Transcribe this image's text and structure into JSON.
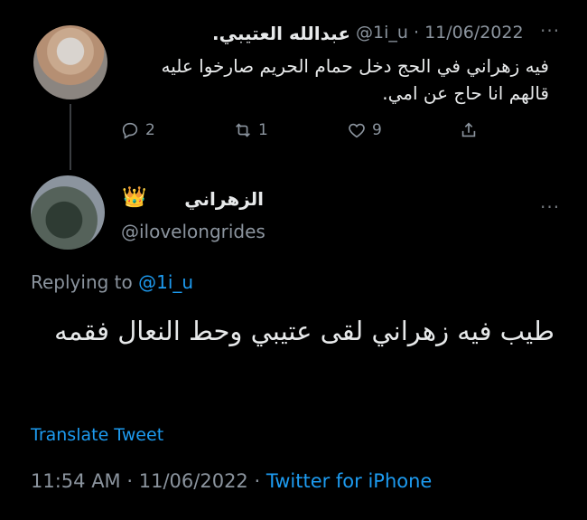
{
  "tweet1": {
    "display_name": "عبدالله العتيبي.",
    "handle": "@1i_u",
    "sep": "·",
    "date": "11/06/2022",
    "text": "فيه زهراني في الحج دخل حمام الحريم صارخوا عليه قالهم انا حاج عن امي.",
    "replies": "2",
    "retweets": "1",
    "likes": "9"
  },
  "tweet2": {
    "display_name": "الزهراني",
    "crown": "👑",
    "handle": "@ilovelongrides",
    "replying_to_label": "Replying to",
    "replying_to_handle": "@1i_u",
    "text": "طيب فيه زهراني لقى عتيبي وحط النعال فقمه",
    "translate_label": "Translate Tweet",
    "time": "11:54 AM",
    "date": "11/06/2022",
    "source": "Twitter for iPhone"
  },
  "more_glyph": "···",
  "icons": {
    "reply": "reply-icon",
    "retweet": "retweet-icon",
    "like": "heart-icon",
    "share": "share-icon"
  }
}
